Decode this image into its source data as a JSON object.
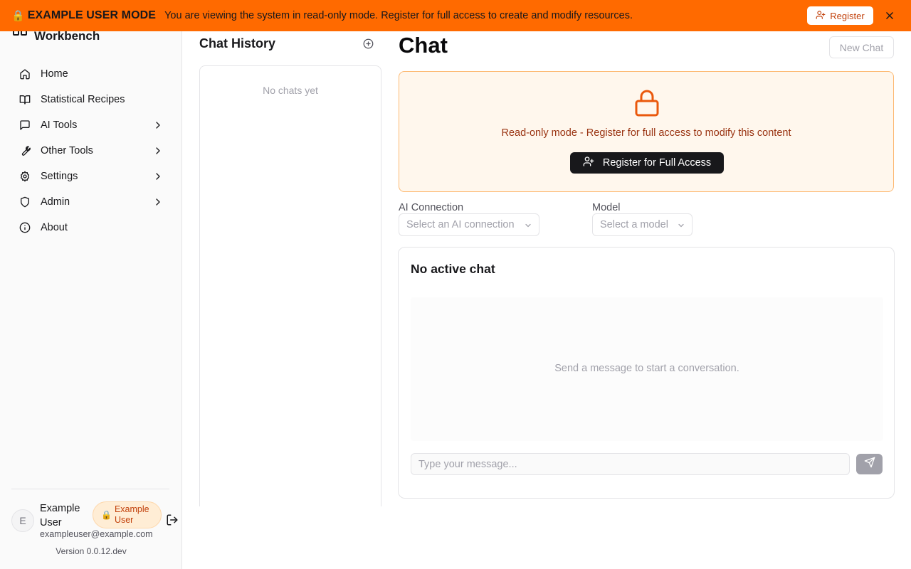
{
  "banner": {
    "lock_glyph": "🔒",
    "title": "EXAMPLE USER MODE",
    "message": "You are viewing the system in read-only mode. Register for full access to create and modify resources.",
    "register_label": "Register",
    "close_icon": "x-icon"
  },
  "sidebar": {
    "brand": "Workbench",
    "items": [
      {
        "label": "Home",
        "icon": "home-icon",
        "has_children": false
      },
      {
        "label": "Statistical Recipes",
        "icon": "book-icon",
        "has_children": false
      },
      {
        "label": "AI Tools",
        "icon": "message-square-icon",
        "has_children": true
      },
      {
        "label": "Other Tools",
        "icon": "wrench-icon",
        "has_children": true
      },
      {
        "label": "Settings",
        "icon": "gear-icon",
        "has_children": true
      },
      {
        "label": "Admin",
        "icon": "shield-icon",
        "has_children": true
      },
      {
        "label": "About",
        "icon": "info-icon",
        "has_children": false
      }
    ],
    "user": {
      "initial": "E",
      "name": "Example User",
      "badge_lock": "🔒",
      "badge": "Example User",
      "email": "exampleuser@example.com"
    },
    "version": "Version 0.0.12.dev"
  },
  "chat_history": {
    "title": "Chat History",
    "empty": "No chats yet"
  },
  "main": {
    "title": "Chat",
    "new_chat": "New Chat",
    "readonly": {
      "message": "Read-only mode - Register for full access to modify this content",
      "button": "Register for Full Access"
    },
    "ai_connection": {
      "label": "AI Connection",
      "placeholder": "Select an AI connection"
    },
    "model": {
      "label": "Model",
      "placeholder": "Select a model"
    },
    "chat": {
      "title": "No active chat",
      "empty": "Send a message to start a conversation.",
      "input_placeholder": "Type your message..."
    }
  },
  "colors": {
    "banner": "#ff6a00",
    "accent_orange": "#ea580c",
    "readonly_bg": "#fff7ed",
    "dark_button": "#18181b"
  }
}
